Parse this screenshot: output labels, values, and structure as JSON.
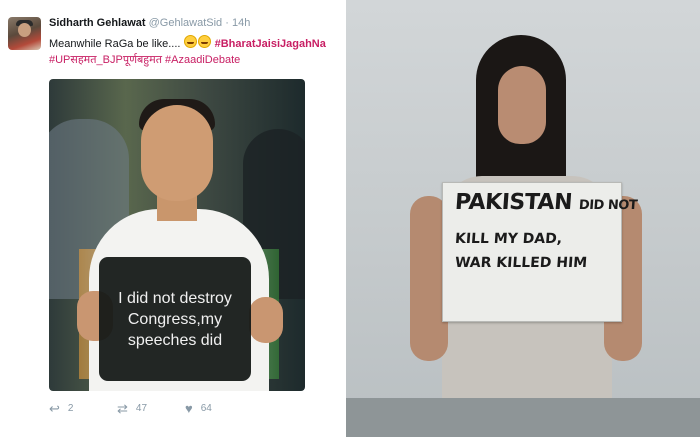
{
  "tweet": {
    "display_name": "Sidharth Gehlawat",
    "handle": "@GehlawatSid",
    "separator": "·",
    "time": "14h",
    "text_prefix": "Meanwhile RaGa be like....",
    "emoji": "tears-of-joy-emoji",
    "hashtags_line1": "#BharatJaisiJagahNa",
    "hashtags_line2": "#UPसहमत_BJPपूर्णबहुमत #AzaadiDebate",
    "image_sign_text": "I did not destroy Congress,my speeches did",
    "actions": {
      "replies": "2",
      "retweets": "47",
      "likes": "64"
    },
    "colors": {
      "hashtag": "#c81e63",
      "meta": "#8899a6"
    }
  },
  "photo": {
    "placard_line1_big": "PAKISTAN",
    "placard_line1_small": "DID NOT",
    "placard_line2": "KILL MY DAD,",
    "placard_line3": "WAR KILLED HIM"
  }
}
